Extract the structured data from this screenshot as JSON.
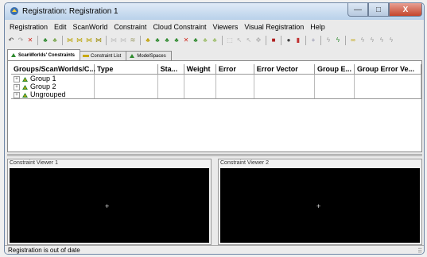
{
  "window": {
    "title": "Registration: Registration 1",
    "controls": {
      "minimize": "—",
      "maximize": "□",
      "close": "X"
    }
  },
  "menu": [
    "Registration",
    "Edit",
    "ScanWorld",
    "Constraint",
    "Cloud Constraint",
    "Viewers",
    "Visual Registration",
    "Help"
  ],
  "toolbar_icons": [
    {
      "name": "undo-icon",
      "glyph": "↶",
      "color": "#333333"
    },
    {
      "name": "redo-icon",
      "glyph": "↷",
      "color": "#999999"
    },
    {
      "name": "delete-icon",
      "glyph": "✕",
      "color": "#d12a1f"
    },
    {
      "name": "sep"
    },
    {
      "name": "scanworld-add-icon",
      "glyph": "♣",
      "color": "#2e8a2e"
    },
    {
      "name": "scanworld-remove-icon",
      "glyph": "♣",
      "color": "#7aa84f"
    },
    {
      "name": "sep"
    },
    {
      "name": "constraint-icon-1",
      "glyph": "⋈",
      "color": "#b8a200"
    },
    {
      "name": "constraint-icon-2",
      "glyph": "⋈",
      "color": "#b8a200"
    },
    {
      "name": "constraint-icon-3",
      "glyph": "⋈",
      "color": "#b8a200"
    },
    {
      "name": "constraint-icon-4",
      "glyph": "⋈",
      "color": "#998800"
    },
    {
      "name": "sep"
    },
    {
      "name": "cloud-icon-1",
      "glyph": "⋈",
      "color": "#c0c0c0"
    },
    {
      "name": "cloud-icon-2",
      "glyph": "⋈",
      "color": "#c0c0c0"
    },
    {
      "name": "cloud-icon-3",
      "glyph": "≋",
      "color": "#a0a070"
    },
    {
      "name": "sep"
    },
    {
      "name": "register-icon-1",
      "glyph": "♣",
      "color": "#c0a000"
    },
    {
      "name": "register-icon-2",
      "glyph": "♣",
      "color": "#2e8a2e"
    },
    {
      "name": "register-icon-3",
      "glyph": "♣",
      "color": "#2e8a2e"
    },
    {
      "name": "register-icon-4",
      "glyph": "♣",
      "color": "#2e8a2e"
    },
    {
      "name": "remove-constraint-icon",
      "glyph": "✕",
      "color": "#d12a1f"
    },
    {
      "name": "register-icon-5",
      "glyph": "♣",
      "color": "#2e8a2e"
    },
    {
      "name": "register-icon-6",
      "glyph": "♣",
      "color": "#a0c070"
    },
    {
      "name": "register-icon-7",
      "glyph": "♣",
      "color": "#a0c070"
    },
    {
      "name": "sep"
    },
    {
      "name": "select-icon-1",
      "glyph": "⬚",
      "color": "#b0b0b0"
    },
    {
      "name": "select-icon-2",
      "glyph": "↖",
      "color": "#b0b0b0"
    },
    {
      "name": "select-icon-3",
      "glyph": "↖",
      "color": "#b0b0b0"
    },
    {
      "name": "move-icon",
      "glyph": "✥",
      "color": "#b0b0b0"
    },
    {
      "name": "sep"
    },
    {
      "name": "lock-icon",
      "glyph": "■",
      "color": "#b02020"
    },
    {
      "name": "sep"
    },
    {
      "name": "target-icon",
      "glyph": "●",
      "color": "#404040"
    },
    {
      "name": "flag-icon",
      "glyph": "▮",
      "color": "#c03030"
    },
    {
      "name": "sep"
    },
    {
      "name": "add-icon",
      "glyph": "+",
      "color": "#8080a0"
    },
    {
      "name": "sep"
    },
    {
      "name": "link-icon-1",
      "glyph": "ϟ",
      "color": "#a0a0a0"
    },
    {
      "name": "link-icon-2",
      "glyph": "ϟ",
      "color": "#2e8a2e"
    },
    {
      "name": "sep"
    },
    {
      "name": "chain-icon-1",
      "glyph": "∞",
      "color": "#c0a000"
    },
    {
      "name": "chain-icon-2",
      "glyph": "ϟ",
      "color": "#a0a0a0"
    },
    {
      "name": "chain-icon-3",
      "glyph": "ϟ",
      "color": "#a0a0a0"
    },
    {
      "name": "chain-icon-4",
      "glyph": "ϟ",
      "color": "#a0a0a0"
    },
    {
      "name": "chain-icon-5",
      "glyph": "ϟ",
      "color": "#a0a0a0"
    }
  ],
  "tabs": [
    {
      "label": "ScanWorlds' Constraints",
      "active": true,
      "icon": "scanworld-constraints-tab-icon"
    },
    {
      "label": "Constraint List",
      "active": false,
      "icon": "constraint-list-tab-icon"
    },
    {
      "label": "ModelSpaces",
      "active": false,
      "icon": "modelspaces-tab-icon"
    }
  ],
  "grid": {
    "columns": [
      "Groups/ScanWorlds/C...",
      "Type",
      "Sta...",
      "Weight",
      "Error",
      "Error Vector",
      "Group E...",
      "Group Error Ve..."
    ],
    "rows": [
      {
        "label": "Group 1",
        "expander": "+"
      },
      {
        "label": "Group 2",
        "expander": "+"
      },
      {
        "label": "Ungrouped",
        "expander": "+"
      }
    ]
  },
  "viewers": [
    {
      "title": "Constraint Viewer 1",
      "cursor": "+"
    },
    {
      "title": "Constraint Viewer 2",
      "cursor": "+"
    }
  ],
  "status": {
    "text": "Registration is out of date",
    "grip": "⠿"
  },
  "colors": {
    "accent": "#2e8a2e",
    "close": "#c4452c",
    "canvas": "#000000"
  }
}
